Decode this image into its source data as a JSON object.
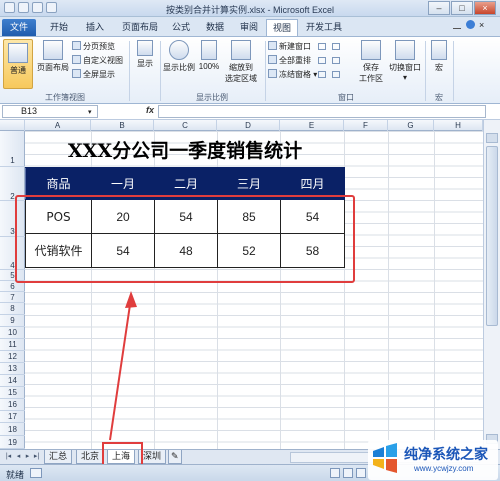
{
  "window": {
    "title": "按类别合并计算实例.xlsx - Microsoft Excel",
    "minimize_icon": "minimize-icon",
    "maximize_icon": "maximize-icon",
    "close_icon": "close-icon"
  },
  "ribbon_tabs": [
    "文件",
    "开始",
    "插入",
    "页面布局",
    "公式",
    "数据",
    "审阅",
    "视图",
    "开发工具"
  ],
  "active_tab": "视图",
  "ribbon": {
    "workbook_views": {
      "label": "工作簿视图",
      "normal": "普通",
      "page_layout": "页面布局",
      "page_break": "分页预览",
      "custom_views": "自定义视图",
      "full_screen": "全屏显示"
    },
    "show": {
      "label": "显示"
    },
    "zoom": {
      "label": "显示比例",
      "zoom": "显示比例",
      "hundred": "100%",
      "zoom_selection": "缩放到",
      "zoom_selection_2": "选定区域"
    },
    "window": {
      "label": "窗口",
      "new_window": "新建窗口",
      "arrange_all": "全部重排",
      "freeze": "冻结窗格",
      "save_workspace": "保存",
      "save_workspace_2": "工作区",
      "switch_windows": "切换窗口"
    },
    "macros": {
      "label": "宏",
      "macros": "宏"
    }
  },
  "formula_bar": {
    "name_box": "B13",
    "fx": "fx",
    "value": ""
  },
  "columns": [
    "A",
    "B",
    "C",
    "D",
    "E",
    "F",
    "G",
    "H"
  ],
  "rows": [
    "1",
    "2",
    "3",
    "4",
    "5",
    "6",
    "7",
    "8",
    "9",
    "10",
    "11",
    "12",
    "13",
    "14",
    "15",
    "16",
    "17",
    "18",
    "19"
  ],
  "sheet": {
    "title": "XXX分公司一季度销售统计",
    "headers": [
      "商品",
      "一月",
      "二月",
      "三月",
      "四月"
    ],
    "rows": [
      [
        "POS",
        "20",
        "54",
        "85",
        "54"
      ],
      [
        "代销软件",
        "54",
        "48",
        "52",
        "58"
      ]
    ]
  },
  "sheet_tabs": [
    "汇总",
    "北京",
    "上海",
    "深圳"
  ],
  "active_sheet": "上海",
  "status": {
    "ready": "就绪"
  },
  "accent": {
    "header_bg": "#0a2166",
    "annotation": "#e03d3d"
  },
  "watermark": {
    "name": "纯净系统之家",
    "url": "www.ycwjzy.com"
  }
}
